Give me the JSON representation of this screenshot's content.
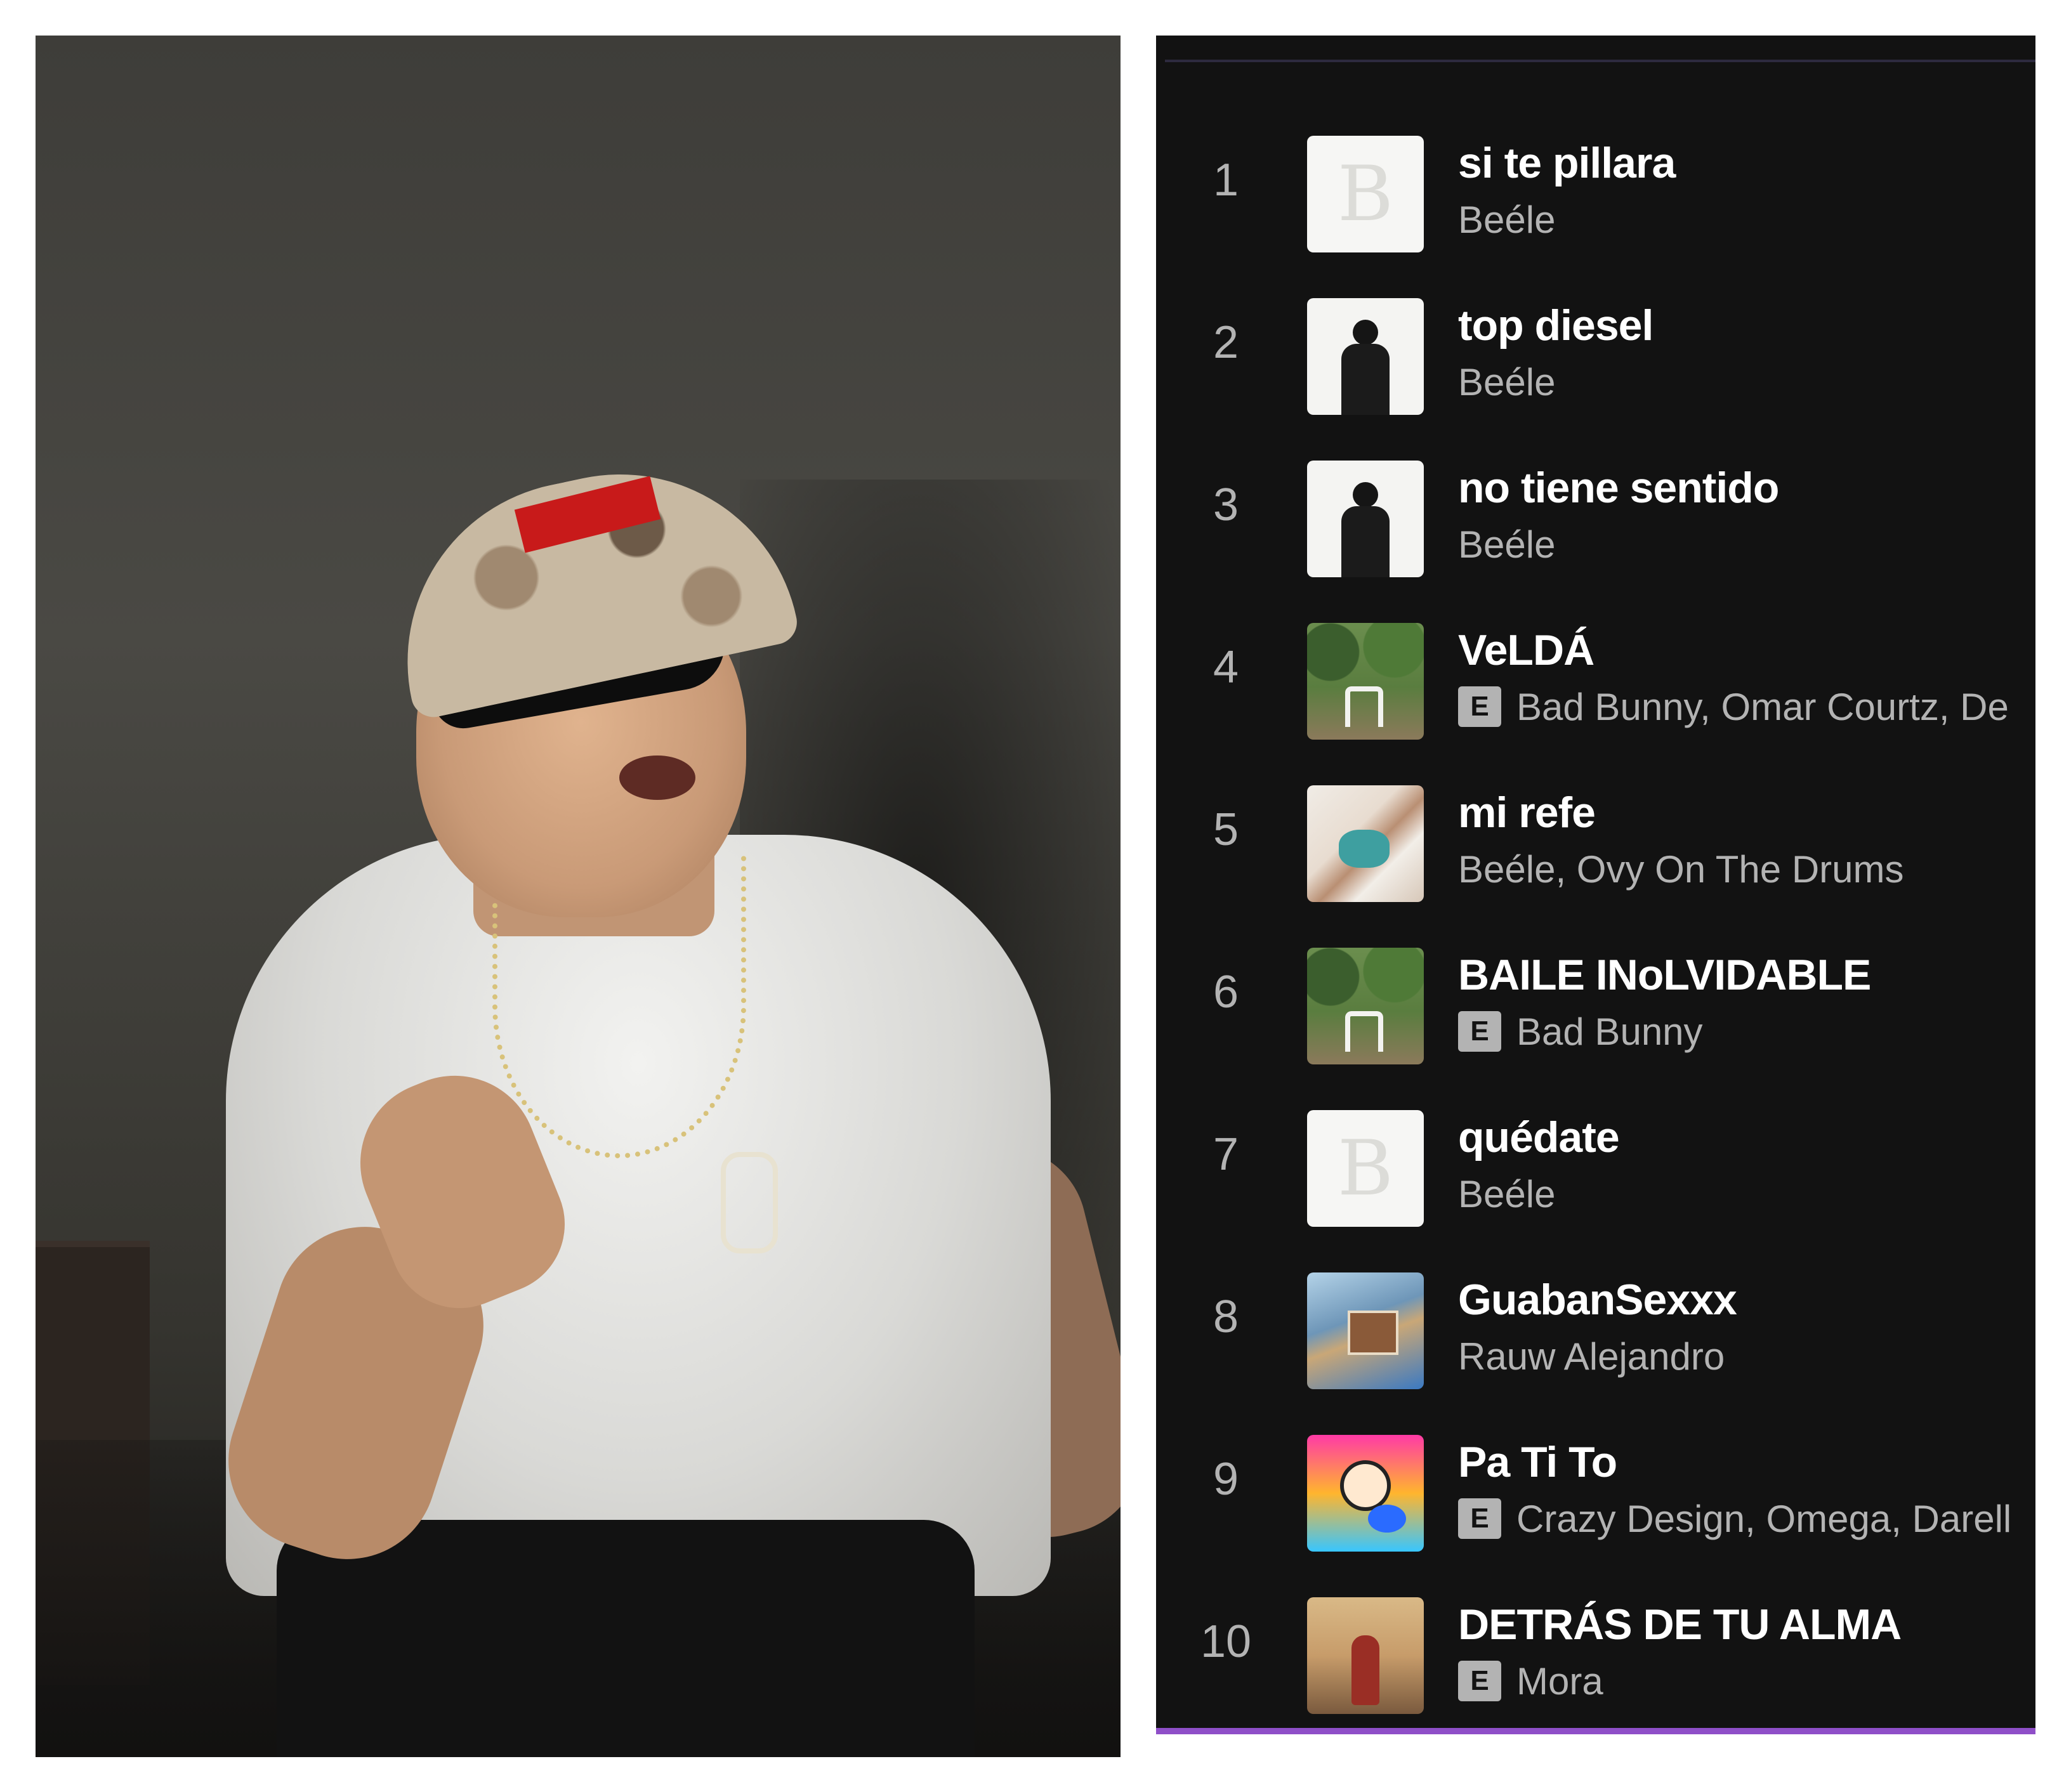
{
  "tracks": [
    {
      "rank": "1",
      "title": "si te pillara",
      "artists": "Beéle",
      "explicit": false,
      "cover": "white-b-monogram"
    },
    {
      "rank": "2",
      "title": "top diesel",
      "artists": "Beéle",
      "explicit": false,
      "cover": "figure-on-white"
    },
    {
      "rank": "3",
      "title": "no tiene sentido",
      "artists": "Beéle",
      "explicit": false,
      "cover": "figure-on-white"
    },
    {
      "rank": "4",
      "title": "VeLDÁ",
      "artists": "Bad Bunny, Omar Courtz, De",
      "explicit": true,
      "cover": "garden-chairs"
    },
    {
      "rank": "5",
      "title": "mi refe",
      "artists": "Beéle, Ovy On The Drums",
      "explicit": false,
      "cover": "couple-in-bed"
    },
    {
      "rank": "6",
      "title": "BAILE INoLVIDABLE",
      "artists": "Bad Bunny",
      "explicit": true,
      "cover": "garden-chairs"
    },
    {
      "rank": "7",
      "title": "quédate",
      "artists": "Beéle",
      "explicit": false,
      "cover": "white-b-monogram"
    },
    {
      "rank": "8",
      "title": "GuabanSexxx",
      "artists": "Rauw Alejandro",
      "explicit": false,
      "cover": "collage"
    },
    {
      "rank": "9",
      "title": "Pa Ti To",
      "artists": "Crazy Design, Omega, Darell",
      "explicit": true,
      "cover": "cartoon"
    },
    {
      "rank": "10",
      "title": "DETRÁS DE TU ALMA",
      "artists": "Mora",
      "explicit": true,
      "cover": "warm-room"
    }
  ],
  "explicit_badge": "E",
  "colors": {
    "panel_bg": "#121212",
    "title": "#ffffff",
    "secondary": "#b3b3b3",
    "accent_bar": "#8f4fc8"
  }
}
